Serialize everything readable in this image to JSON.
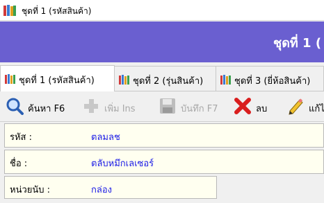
{
  "window": {
    "title": "ชุดที่ 1 (รหัสสินค้า)"
  },
  "banner": {
    "title": "ชุดที่ 1 ("
  },
  "tabs": [
    {
      "label": "ชุดที่ 1 (รหัสสินค้า)",
      "icon": "books-icon",
      "active": true
    },
    {
      "label": "ชุดที่ 2 (รุ่นสินค้า)",
      "icon": "books-icon",
      "active": false
    },
    {
      "label": "ชุดที่ 3 (ยี่ห้อสินค้า)",
      "icon": "books-icon",
      "active": false
    }
  ],
  "toolbar": {
    "search": {
      "label": "ค้นหา F6",
      "icon": "search-icon",
      "enabled": true
    },
    "add": {
      "label": "เพิ่ม Ins",
      "icon": "plus-icon",
      "enabled": false
    },
    "save": {
      "label": "บันทึก F7",
      "icon": "floppy-disk-icon",
      "enabled": false
    },
    "delete": {
      "label": "ลบ",
      "icon": "red-x-icon",
      "enabled": true
    },
    "edit": {
      "label": "แก้ไ",
      "icon": "pencil-icon",
      "enabled": true
    }
  },
  "form": {
    "code": {
      "label": "รหัส :",
      "value": "ตลมลช"
    },
    "name": {
      "label": "ชื่อ :",
      "value": "ตลับหมึกเลเซอร์"
    },
    "unit": {
      "label": "หน่วยนับ :",
      "value": "กล่อง"
    }
  },
  "colors": {
    "banner": "#6a5fd0",
    "value_text": "#1a1ae6",
    "field_bg": "#fffff0"
  }
}
